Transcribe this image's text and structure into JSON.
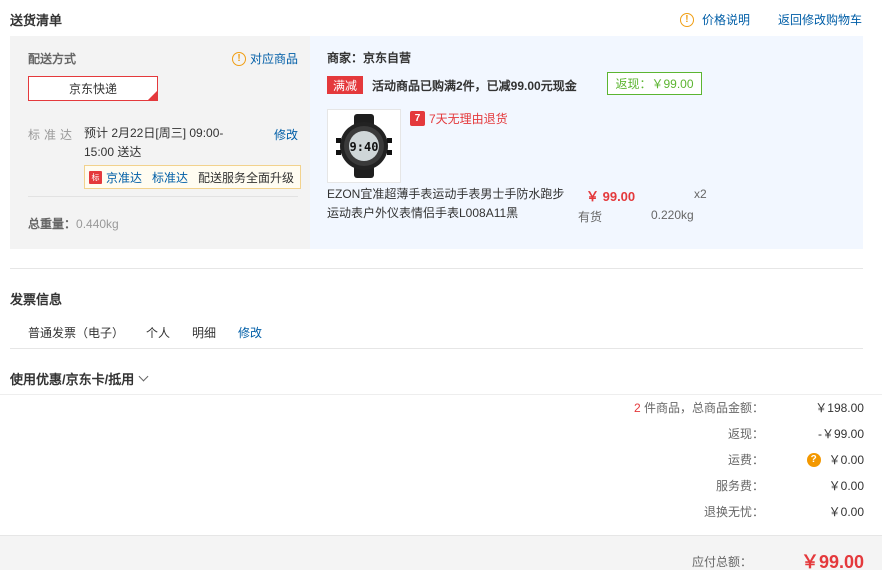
{
  "header": {
    "title": "送货清单",
    "price_note": "价格说明",
    "back_to_cart": "返回修改购物车"
  },
  "shipping": {
    "method_title": "配送方式",
    "corresponding_items": "对应商品",
    "carrier": "京东快递",
    "standard_label": "标准达",
    "standard_text": "预计 2月22日[周三] 09:00-15:00 送达",
    "edit": "修改",
    "jzd_badge": "标",
    "jzd_name": "京准达",
    "jzd_std": "标准达",
    "jzd_upgrade": "配送服务全面升级",
    "weight_label": "总重量：",
    "weight_value": "0.440kg"
  },
  "merchant": {
    "name": "商家：京东自营",
    "promo_tag": "满减",
    "promo_text": "活动商品已购满2件，已减99.00元现金",
    "cashback": "返现：￥99.00"
  },
  "product": {
    "return_badge": "7",
    "return_text": "7天无理由退货",
    "name": "EZON宜准超薄手表运动手表男士手防水跑步运动表户外仪表情侣手表L008A11黑",
    "price": "￥ 99.00",
    "qty": "x2",
    "stock": "有货",
    "weight": "0.220kg",
    "watch_face": "9:40"
  },
  "invoice": {
    "title": "发票信息",
    "type": "普通发票（电子）",
    "owner": "个人",
    "detail": "明细",
    "edit": "修改"
  },
  "coupon": {
    "title": "使用优惠/京东卡/抵用"
  },
  "summary": {
    "items_count": "2",
    "items_label": " 件商品，总商品金额：",
    "items_value": "￥198.00",
    "cashback_label": "返现：",
    "cashback_value": "-￥99.00",
    "shipping_label": "运费：",
    "shipping_value": "￥0.00",
    "service_label": "服务费：",
    "service_value": "￥0.00",
    "worry_free_label": "退换无忧：",
    "worry_free_value": "￥0.00",
    "total_label": "应付总额：",
    "total_value": "￥99.00"
  },
  "colors": {
    "accent_red": "#e4393c",
    "link_blue": "#005ea7",
    "cashback_green": "#5cb531",
    "info_orange": "#f09e14"
  }
}
